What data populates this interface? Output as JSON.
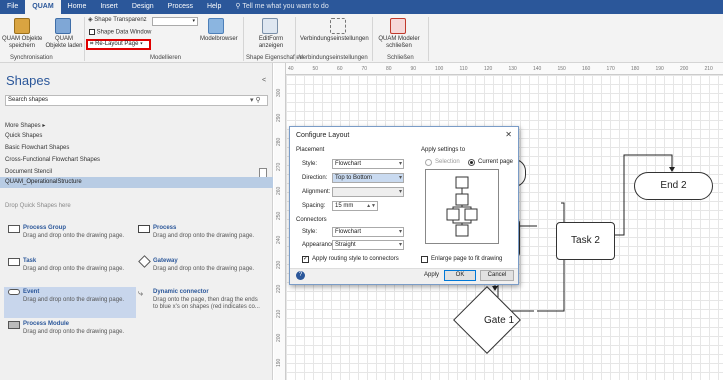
{
  "ribbon_tabs": [
    "File",
    "QUAM",
    "Home",
    "Insert",
    "Design",
    "Process",
    "Help"
  ],
  "tell_me": "Tell me what you want to do",
  "ribbon": {
    "shape_transparency": "Shape Transparenz",
    "shape_data_window": "Shape Data Window",
    "relayout_page": "Re-Layout Page",
    "quam_save_l1": "QUAM Objekte",
    "quam_save_l2": "speichern",
    "quam_load_l1": "QUAM",
    "quam_load_l2": "Objekte laden",
    "modelbrowser": "Modelbrowser",
    "editform_l1": "EditForm",
    "editform_l2": "anzeigen",
    "connection_settings": "Verbindungseinstellungen",
    "close_modeler_l1": "QUAM Modeler",
    "close_modeler_l2": "schließen",
    "groups": [
      "Synchronisation",
      "Modellieren",
      "Shape Eigenschaften",
      "Verbindungseinstellungen",
      "Schließen"
    ]
  },
  "pane": {
    "title": "Shapes",
    "collapse": "<",
    "search_placeholder": "Search shapes",
    "more_shapes": "More Shapes  ▸",
    "links": [
      "Quick Shapes",
      "Basic Flowchart Shapes",
      "Cross-Functional Flowchart Shapes",
      "Document Stencil"
    ],
    "active_stencil": "QUAM_OperationalStructure",
    "drop_hint": "Drop Quick Shapes here",
    "shapes": [
      {
        "name": "Process Group",
        "desc": "Drag and drop onto the drawing page.",
        "desc2": ""
      },
      {
        "name": "Process",
        "desc": "Drag and drop onto the drawing page.",
        "desc2": ""
      },
      {
        "name": "Task",
        "desc": "Drag and drop onto the drawing page.",
        "desc2": ""
      },
      {
        "name": "Gateway",
        "desc": "Drag and drop onto the drawing page.",
        "desc2": ""
      },
      {
        "name": "Event",
        "desc": "Drag and drop onto the drawing page.",
        "desc2": ""
      },
      {
        "name": "Dynamic connector",
        "desc": "Drag onto the page, then drag the ends",
        "desc2": "to blue x's on shapes (red indicates co..."
      },
      {
        "name": "Process Module",
        "desc": "Drag and drop onto the drawing page.",
        "desc2": ""
      }
    ]
  },
  "ruler": {
    "h_ticks": [
      "40",
      "50",
      "60",
      "70",
      "80",
      "90",
      "100",
      "110",
      "120",
      "130",
      "140",
      "150",
      "160",
      "170",
      "180",
      "190",
      "200",
      "210"
    ],
    "v_ticks": [
      "300",
      "290",
      "280",
      "270",
      "260",
      "250",
      "240",
      "230",
      "220",
      "210",
      "200",
      "190"
    ]
  },
  "canvas": {
    "task2": "Task 2",
    "end2": "End 2",
    "gate1": "Gate 1"
  },
  "dialog": {
    "title": "Configure Layout",
    "close": "✕",
    "placement": "Placement",
    "style_label": "Style:",
    "style_value": "Flowchart",
    "direction_label": "Direction:",
    "direction_value": "Top to Bottom",
    "alignment_label": "Alignment:",
    "spacing_label": "Spacing:",
    "spacing_value": "15 mm",
    "connectors": "Connectors",
    "conn_style_label": "Style:",
    "conn_style_value": "Flowchart",
    "appearance_label": "Appearance:",
    "appearance_value": "Straight",
    "apply_routing": "Apply routing style to connectors",
    "apply_settings_to": "Apply settings to",
    "selection": "Selection",
    "current_page": "Current page",
    "enlarge_page": "Enlarge page to fit drawing",
    "help": "?",
    "apply_btn": "Apply",
    "ok_btn": "OK",
    "cancel_btn": "Cancel"
  },
  "colors": {
    "ribbon_blue": "#2b579a",
    "highlight_red": "#e00000",
    "selected_item": "#b8cce4"
  }
}
